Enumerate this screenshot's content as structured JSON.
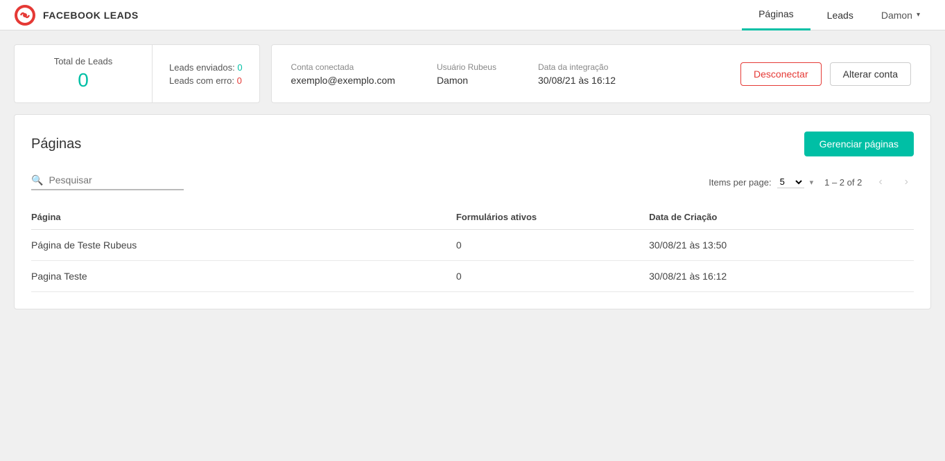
{
  "header": {
    "app_logo_text": "C",
    "app_title": "FACEBOOK LEADS",
    "nav": [
      {
        "id": "paginas",
        "label": "Páginas",
        "active": true
      },
      {
        "id": "leads",
        "label": "Leads",
        "active": false
      }
    ],
    "user": {
      "name": "Damon"
    }
  },
  "stats": {
    "total_label": "Total de Leads",
    "total_value": "0",
    "sent_label": "Leads enviados:",
    "sent_value": "0",
    "error_label": "Leads com erro:",
    "error_value": "0"
  },
  "account": {
    "conta_label": "Conta conectada",
    "conta_value": "exemplo@exemplo.com",
    "usuario_label": "Usuário Rubeus",
    "usuario_value": "Damon",
    "data_label": "Data da integração",
    "data_value": "30/08/21 às 16:12",
    "btn_disconnect": "Desconectar",
    "btn_change": "Alterar conta"
  },
  "pages_section": {
    "title": "Páginas",
    "btn_manage": "Gerenciar páginas",
    "search_placeholder": "Pesquisar",
    "items_per_page_label": "Items per page:",
    "items_per_page_value": "5",
    "pagination_info": "1 – 2 of 2",
    "table": {
      "col_page": "Página",
      "col_forms": "Formulários ativos",
      "col_date": "Data de Criação",
      "rows": [
        {
          "page": "Página de Teste Rubeus",
          "forms": "0",
          "date": "30/08/21 às 13:50"
        },
        {
          "page": "Pagina Teste",
          "forms": "0",
          "date": "30/08/21 às 16:12"
        }
      ]
    }
  }
}
